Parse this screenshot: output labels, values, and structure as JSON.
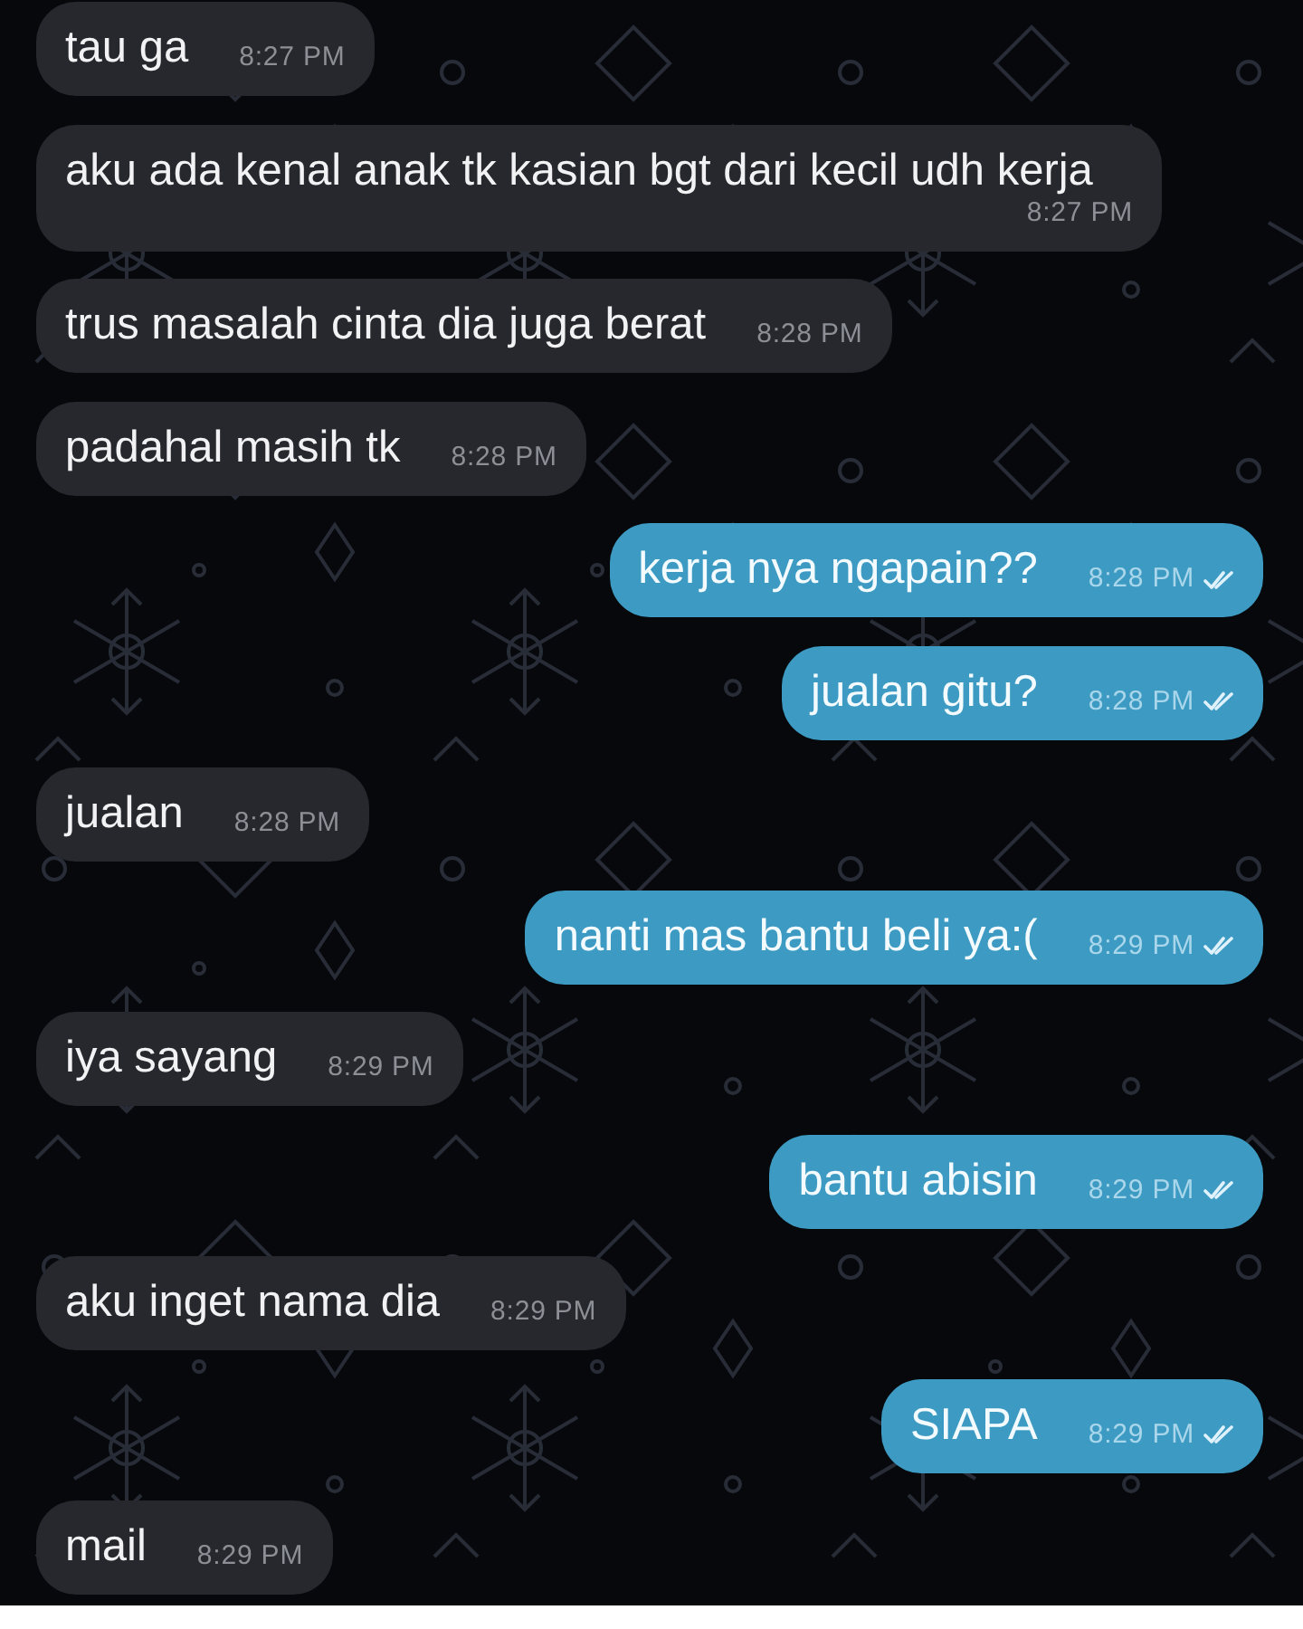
{
  "messages": [
    {
      "kind": "incoming",
      "text": "tau ga",
      "time": "8:27 PM"
    },
    {
      "kind": "incoming",
      "text": "aku ada kenal anak tk kasian bgt dari kecil udh kerja",
      "time": "8:27 PM"
    },
    {
      "kind": "incoming",
      "text": "trus masalah cinta dia juga berat",
      "time": "8:28 PM"
    },
    {
      "kind": "incoming",
      "text": "padahal masih tk",
      "time": "8:28 PM"
    },
    {
      "kind": "outgoing",
      "text": "kerja nya ngapain??",
      "time": "8:28 PM",
      "read": true
    },
    {
      "kind": "outgoing",
      "text": "jualan gitu?",
      "time": "8:28 PM",
      "read": true
    },
    {
      "kind": "incoming",
      "text": "jualan",
      "time": "8:28 PM"
    },
    {
      "kind": "outgoing",
      "text": "nanti mas bantu beli ya:(",
      "time": "8:29 PM",
      "read": true
    },
    {
      "kind": "incoming",
      "text": "iya sayang",
      "time": "8:29 PM"
    },
    {
      "kind": "outgoing",
      "text": "bantu abisin",
      "time": "8:29 PM",
      "read": true
    },
    {
      "kind": "incoming",
      "text": "aku inget nama dia",
      "time": "8:29 PM"
    },
    {
      "kind": "outgoing",
      "text": "SIAPA",
      "time": "8:29 PM",
      "read": true
    },
    {
      "kind": "incoming",
      "text": "mail",
      "time": "8:29 PM"
    }
  ]
}
